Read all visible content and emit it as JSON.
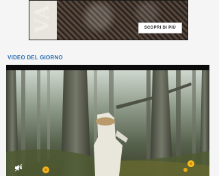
{
  "ad": {
    "brand_partial": "VAL",
    "cta_label": "SCOPRI DI PIÙ"
  },
  "section": {
    "title": "VIDEO DEL GIORNO"
  },
  "video": {
    "mute_icon": "volume-muted-icon",
    "muted": true
  },
  "colors": {
    "section_title": "#2a6fb4",
    "video_bg": "#0b0b0b",
    "page_bg": "#f5f5f5"
  }
}
